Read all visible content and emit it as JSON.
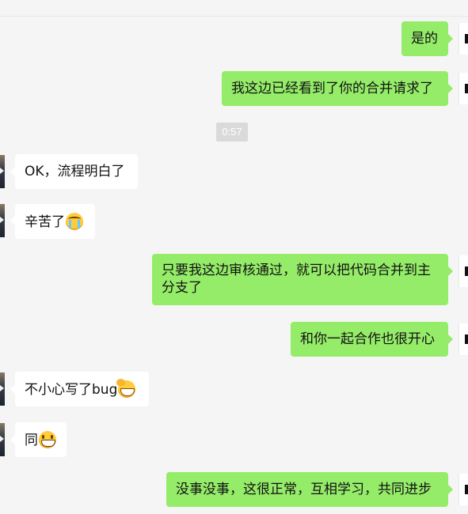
{
  "chat": {
    "timestamp": "0:57",
    "messages": [
      {
        "from": "me",
        "text": "是的"
      },
      {
        "from": "me",
        "text": "我这边已经看到了你的合并请求了"
      },
      {
        "from": "peer",
        "text": "OK，流程明白了"
      },
      {
        "from": "peer",
        "text": "辛苦了",
        "emoji": "crying-face-emoji"
      },
      {
        "from": "me",
        "text": "只要我这边审核通过，就可以把代码合并到主分支了"
      },
      {
        "from": "me",
        "text": "和你一起合作也很开心"
      },
      {
        "from": "peer",
        "text": "不小心写了bug",
        "emoji": "facepalm-emoji"
      },
      {
        "from": "peer",
        "text": "同",
        "emoji": "grinning-face-emoji"
      },
      {
        "from": "me",
        "text": "没事没事，这很正常，互相学习，共同进步"
      }
    ]
  },
  "colors": {
    "background": "#f5f5f5",
    "outgoing_bubble": "#95ec69",
    "incoming_bubble": "#ffffff",
    "timestamp_bg": "#dadada"
  }
}
